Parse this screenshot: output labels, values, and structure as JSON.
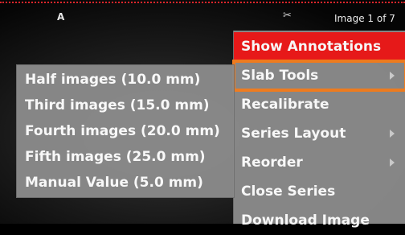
{
  "viewport": {
    "orientation_label": "A",
    "image_counter": "Image 1 of 7",
    "tool_icon": "scissors-icon"
  },
  "context_menu": {
    "items": [
      {
        "label": "Show Annotations",
        "highlighted": true
      },
      {
        "label": "Slab Tools",
        "has_submenu": true,
        "outlined": true
      },
      {
        "label": "Recalibrate"
      },
      {
        "label": "Series Layout",
        "has_submenu": true
      },
      {
        "label": "Reorder",
        "has_submenu": true
      },
      {
        "label": "Close Series"
      },
      {
        "label": "Download Image"
      }
    ]
  },
  "slab_submenu": {
    "items": [
      {
        "label": "Half images (10.0 mm)"
      },
      {
        "label": "Third images (15.0 mm)"
      },
      {
        "label": "Fourth images (20.0 mm)"
      },
      {
        "label": "Fifth images (25.0 mm)"
      },
      {
        "label": "Manual Value (5.0 mm)"
      }
    ]
  },
  "colors": {
    "highlight": "#ee1a1a",
    "focus_outline": "#f57f20",
    "menu_bg": "#8a8a8a",
    "border_dotted": "#e0262b"
  }
}
